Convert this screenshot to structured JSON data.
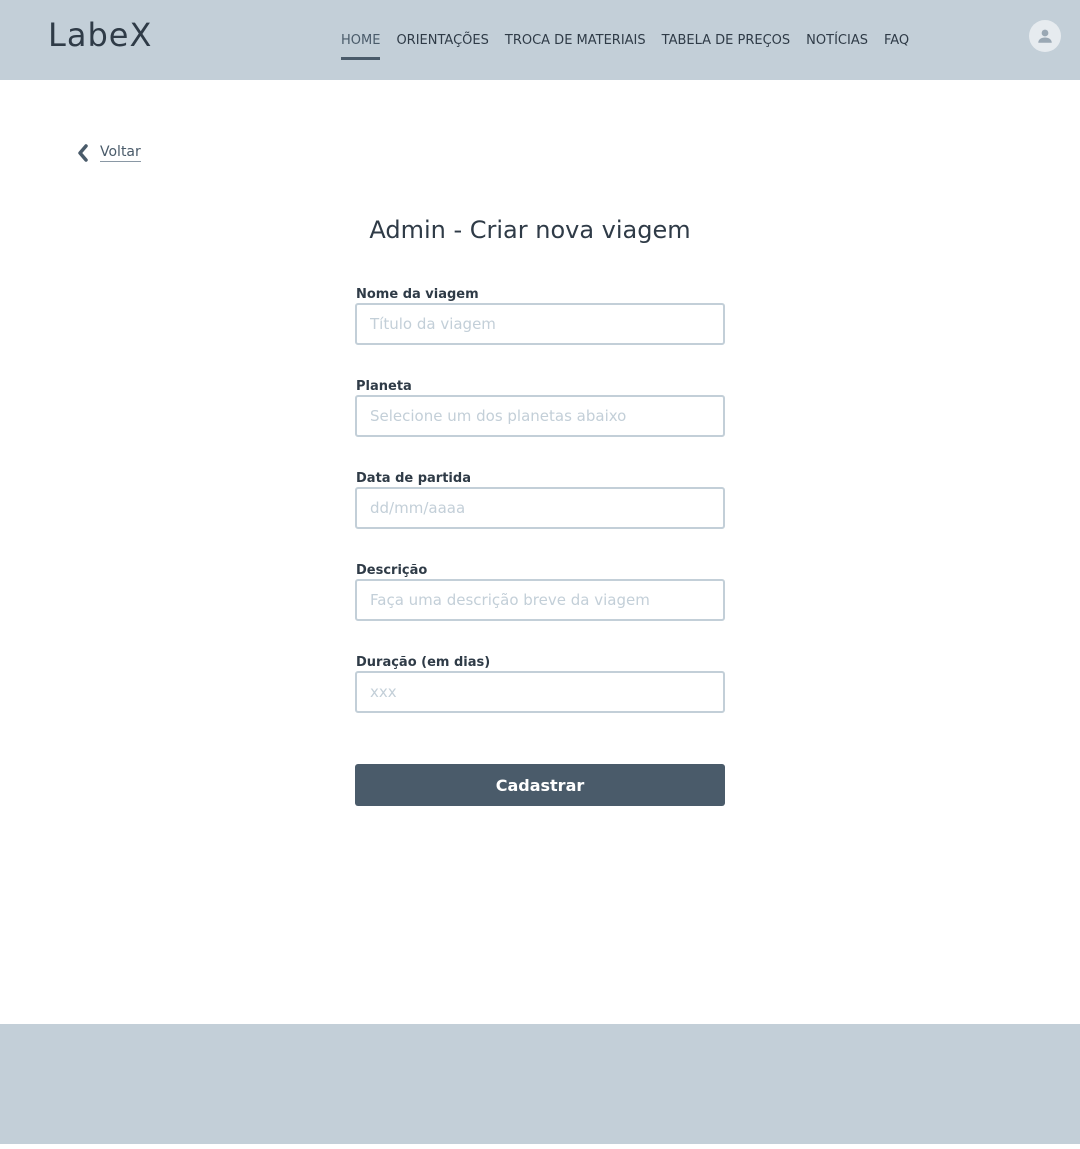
{
  "header": {
    "logo": "LabeX",
    "nav": [
      {
        "label": "HOME",
        "active": true
      },
      {
        "label": "ORIENTAÇÕES",
        "active": false
      },
      {
        "label": "TROCA DE MATERIAIS",
        "active": false
      },
      {
        "label": "TABELA DE PREÇOS",
        "active": false
      },
      {
        "label": "NOTÍCIAS",
        "active": false
      },
      {
        "label": "FAQ",
        "active": false
      }
    ],
    "avatar_icon": "user-icon"
  },
  "back": {
    "label": "Voltar",
    "icon": "chevron-left-icon"
  },
  "form": {
    "title": "Admin - Criar nova viagem",
    "fields": [
      {
        "label": "Nome da viagem",
        "placeholder": "Título da viagem",
        "value": ""
      },
      {
        "label": "Planeta",
        "placeholder": "Selecione um dos planetas abaixo",
        "value": ""
      },
      {
        "label": "Data de partida",
        "placeholder": "dd/mm/aaaa",
        "value": ""
      },
      {
        "label": "Descrição",
        "placeholder": "Faça uma descrição breve da viagem",
        "value": ""
      },
      {
        "label": "Duração (em dias)",
        "placeholder": "xxx",
        "value": ""
      }
    ],
    "submit_label": "Cadastrar"
  },
  "colors": {
    "header_bg": "#c3cfd8",
    "footer_bg": "#c3cfd8",
    "primary": "#4a5b6a",
    "text": "#2f3b47",
    "input_border": "#c3cfd8"
  }
}
